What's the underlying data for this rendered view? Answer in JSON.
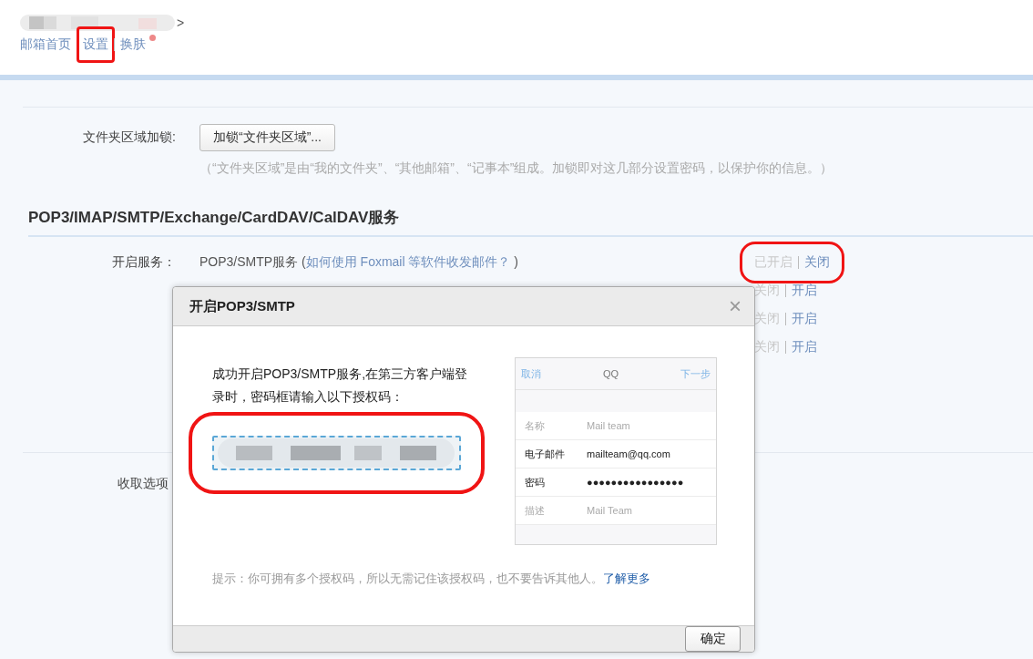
{
  "header": {
    "account_suffix": ">",
    "nav": [
      {
        "label": "邮箱首页",
        "highlighted": false,
        "badge": false
      },
      {
        "label": "设置",
        "highlighted": true,
        "badge": false
      },
      {
        "label": "换肤",
        "highlighted": false,
        "badge": true
      }
    ]
  },
  "folder_lock": {
    "label": "文件夹区域加锁:",
    "button": "加锁“文件夹区域”...",
    "hint": "（“文件夹区域”是由“我的文件夹”、“其他邮箱”、“记事本”组成。加锁即对这几部分设置密码，以保护你的信息。）"
  },
  "services_section": {
    "title": "POP3/IMAP/SMTP/Exchange/CardDAV/CalDAV服务",
    "label": "开启服务：",
    "services": [
      {
        "name": "POP3/SMTP服务",
        "help_open": "(",
        "help_link": "如何使用 Foxmail 等软件收发邮件？",
        "help_close": ")",
        "status": "已开启",
        "action": "关闭",
        "highlighted": true
      },
      {
        "status": "关闭",
        "action": "开启",
        "highlighted": false
      },
      {
        "status": "关闭",
        "action": "开启",
        "highlighted": false
      },
      {
        "status": "关闭",
        "action": "开启",
        "highlighted": false
      }
    ]
  },
  "receive_options": {
    "label": "收取选项"
  },
  "dialog": {
    "title": "开启POP3/SMTP",
    "close": "×",
    "message": "成功开启POP3/SMTP服务,在第三方客户端登录时，密码框请输入以下授权码：",
    "code_highlighted": true,
    "preview": {
      "cancel": "取消",
      "title": "QQ",
      "next": "下一步",
      "fields": [
        {
          "label": "名称",
          "value": "Mail team",
          "filled": false
        },
        {
          "label": "电子邮件",
          "value": "mailteam@qq.com",
          "filled": true
        },
        {
          "label": "密码",
          "value": "●●●●●●●●●●●●●●●●",
          "filled": true
        },
        {
          "label": "描述",
          "value": "Mail Team",
          "filled": false
        }
      ]
    },
    "tip": "提示：你可拥有多个授权码，所以无需记住该授权码，也不要告诉其他人。",
    "tip_link": "了解更多",
    "ok": "确定"
  }
}
